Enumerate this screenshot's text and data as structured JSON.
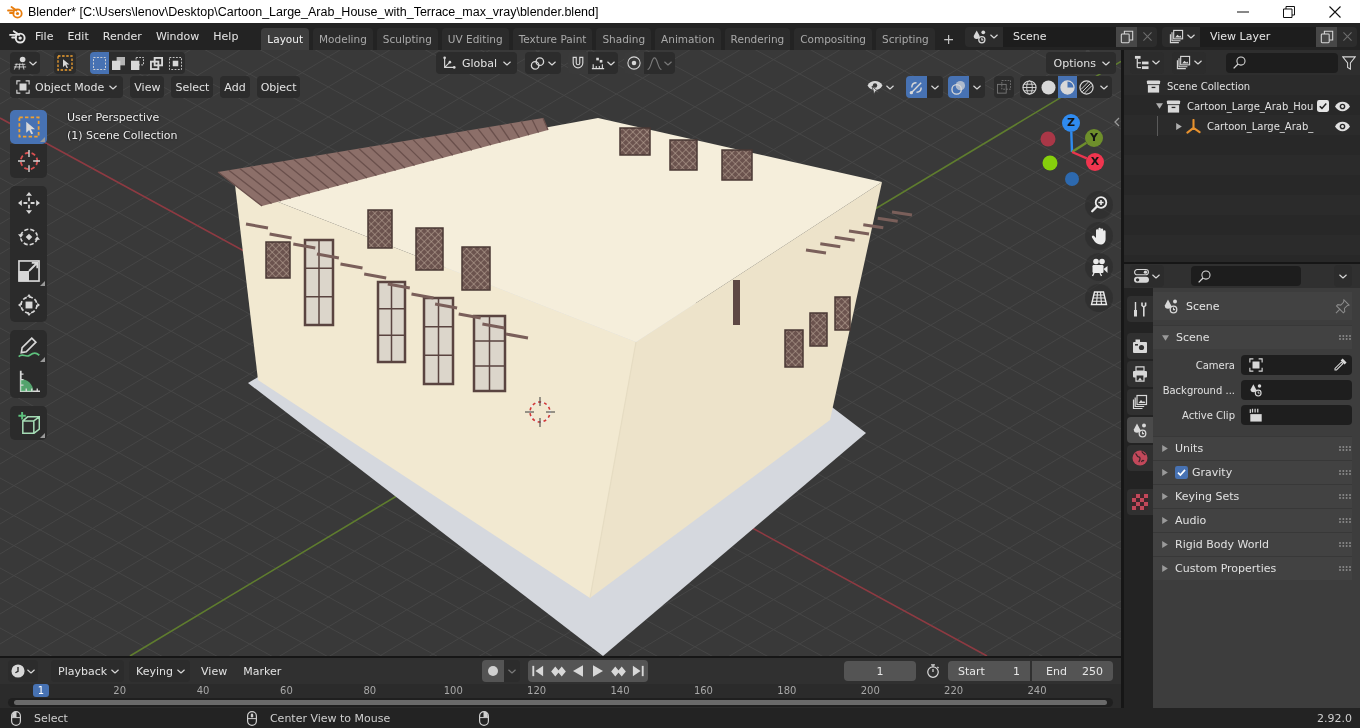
{
  "window": {
    "title": "Blender* [C:\\Users\\lenov\\Desktop\\Cartoon_Large_Arab_House_with_Terrace_max_vray\\blender.blend]"
  },
  "top_bar": {
    "menu": [
      "File",
      "Edit",
      "Render",
      "Window",
      "Help"
    ],
    "workspaces": [
      {
        "label": "Layout",
        "selected": true
      },
      {
        "label": "Modeling",
        "selected": false
      },
      {
        "label": "Sculpting",
        "selected": false
      },
      {
        "label": "UV Editing",
        "selected": false
      },
      {
        "label": "Texture Paint",
        "selected": false
      },
      {
        "label": "Shading",
        "selected": false
      },
      {
        "label": "Animation",
        "selected": false
      },
      {
        "label": "Rendering",
        "selected": false
      },
      {
        "label": "Compositing",
        "selected": false
      },
      {
        "label": "Scripting",
        "selected": false
      }
    ],
    "add_workspace": "+",
    "scene": "Scene",
    "view_layer": "View Layer"
  },
  "viewport": {
    "tool_settings": {
      "select_modes": [
        {
          "selected": true
        },
        {
          "selected": false
        },
        {
          "selected": false
        },
        {
          "selected": false
        },
        {
          "selected": false
        }
      ],
      "orientation": "Global",
      "snap": false,
      "proportional_editing": false,
      "options": "Options"
    },
    "header": {
      "mode": "Object Mode",
      "menus": [
        "View",
        "Select",
        "Add",
        "Object"
      ],
      "gizmos": true,
      "overlays": true,
      "xray": false,
      "shading": [
        {
          "selected": false
        },
        {
          "selected": false
        },
        {
          "selected": true
        },
        {
          "selected": false
        }
      ]
    },
    "info": [
      "User Perspective",
      "(1) Scene Collection"
    ],
    "tools": [
      {
        "selected": true
      },
      {
        "selected": false
      },
      {
        "selected": false
      },
      {
        "selected": false
      },
      {
        "selected": false
      },
      {
        "selected": false
      },
      {
        "selected": false
      },
      {
        "selected": false
      },
      {
        "selected": false
      }
    ],
    "axes": [
      "Z",
      "Y",
      "X"
    ]
  },
  "outliner": {
    "items": [
      {
        "label": "Scene Collection",
        "kind": "collection",
        "children": [
          {
            "label": "Cartoon_Large_Arab_Hou",
            "kind": "collection",
            "expanded": true,
            "checked": true,
            "visible": true,
            "children": [
              {
                "label": "Cartoon_Large_Arab_",
                "kind": "empty",
                "expanded": false,
                "visible": true
              }
            ]
          }
        ]
      }
    ]
  },
  "properties": {
    "tabs": [
      {
        "selected": false
      },
      {
        "selected": false
      },
      {
        "selected": false
      },
      {
        "selected": false
      },
      {
        "selected": true
      },
      {
        "selected": false
      },
      {
        "selected": false
      }
    ],
    "context": "Scene",
    "panels": [
      {
        "title": "Scene",
        "expanded": true,
        "fields": [
          {
            "label": "Camera",
            "kind": "object"
          },
          {
            "label": "Background ...",
            "kind": "scene"
          },
          {
            "label": "Active Clip",
            "kind": "clip"
          }
        ]
      },
      {
        "title": "Units",
        "expanded": false
      },
      {
        "title": "Gravity",
        "expanded": false,
        "checked": true
      },
      {
        "title": "Keying Sets",
        "expanded": false
      },
      {
        "title": "Audio",
        "expanded": false
      },
      {
        "title": "Rigid Body World",
        "expanded": false
      },
      {
        "title": "Custom Properties",
        "expanded": false
      }
    ]
  },
  "timeline": {
    "menus": [
      {
        "label": "Playback",
        "kind": "dropdown"
      },
      {
        "label": "Keying",
        "kind": "dropdown"
      },
      {
        "label": "View",
        "kind": "menu"
      },
      {
        "label": "Marker",
        "kind": "menu"
      }
    ],
    "auto_keying": false,
    "current_frame": "1",
    "start_label": "Start",
    "start": "1",
    "end_label": "End",
    "end": "250",
    "playhead": "1",
    "ruler": [
      "20",
      "40",
      "60",
      "80",
      "100",
      "120",
      "140",
      "160",
      "180",
      "200",
      "220",
      "240"
    ]
  },
  "status_bar": {
    "hints": [
      "Select",
      "Center View to Mouse"
    ],
    "version": "2.92.0"
  }
}
